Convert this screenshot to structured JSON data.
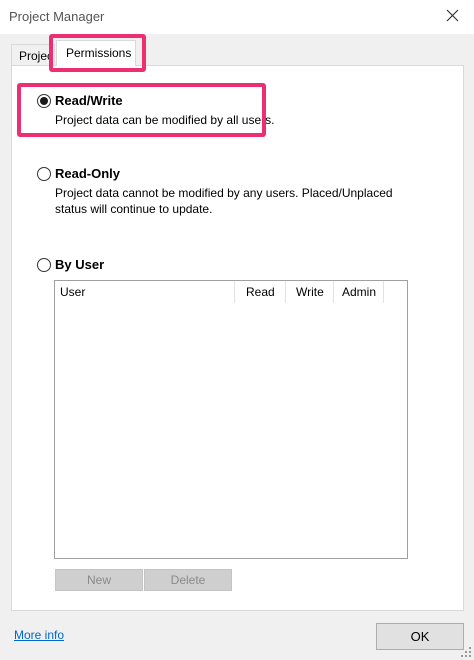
{
  "window": {
    "title": "Project Manager"
  },
  "tabs": [
    {
      "label": "Project"
    },
    {
      "label": "Permissions"
    }
  ],
  "permissions": {
    "options": [
      {
        "label": "Read/Write",
        "description": [
          "Project data can be modified by all users."
        ],
        "selected": true
      },
      {
        "label": "Read-Only",
        "description": [
          "Project data cannot be modified by any users.  Placed/Unplaced",
          "status will continue to update."
        ],
        "selected": false
      },
      {
        "label": "By User",
        "description": [],
        "selected": false
      }
    ],
    "user_table": {
      "columns": [
        "User",
        "Read",
        "Write",
        "Admin"
      ],
      "rows": []
    },
    "buttons": {
      "new": "New",
      "delete": "Delete"
    }
  },
  "footer": {
    "more_info": "More info",
    "ok": "OK"
  },
  "colors": {
    "highlight": "#ec2f73",
    "link": "#0066cc"
  }
}
